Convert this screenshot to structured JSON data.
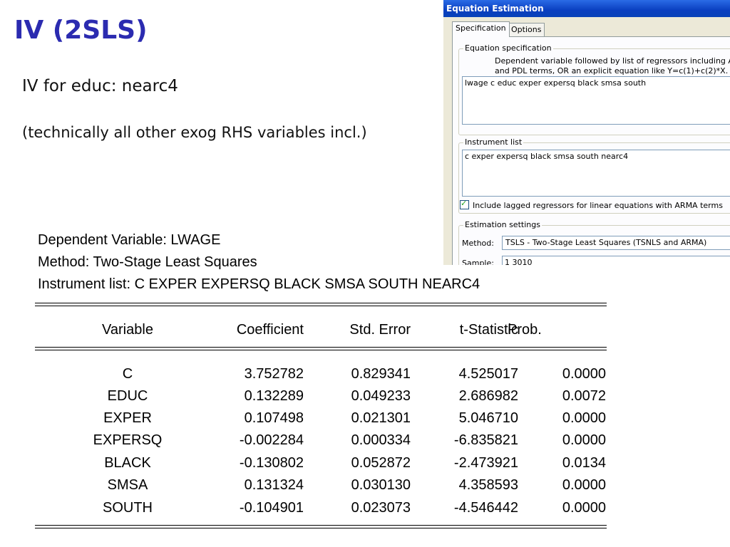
{
  "slide": {
    "title": "IV (2SLS)",
    "line1": "IV for educ: nearc4",
    "line2": "(technically all other exog RHS variables incl.)"
  },
  "output": {
    "dependent": "Dependent Variable: LWAGE",
    "method": "Method: Two-Stage Least Squares",
    "instruments": "Instrument list: C EXPER EXPERSQ BLACK SMSA SOUTH NEARC4",
    "headers": [
      "Variable",
      "Coefficient",
      "Std. Error",
      "t-Statistic",
      "Prob."
    ],
    "rows": [
      {
        "variable": "C",
        "coef": "3.752782",
        "se": "0.829341",
        "t": "4.525017",
        "p": "0.0000"
      },
      {
        "variable": "EDUC",
        "coef": "0.132289",
        "se": "0.049233",
        "t": "2.686982",
        "p": "0.0072"
      },
      {
        "variable": "EXPER",
        "coef": "0.107498",
        "se": "0.021301",
        "t": "5.046710",
        "p": "0.0000"
      },
      {
        "variable": "EXPERSQ",
        "coef": "-0.002284",
        "se": "0.000334",
        "t": "-6.835821",
        "p": "0.0000"
      },
      {
        "variable": "BLACK",
        "coef": "-0.130802",
        "se": "0.052872",
        "t": "-2.473921",
        "p": "0.0134"
      },
      {
        "variable": "SMSA",
        "coef": "0.131324",
        "se": "0.030130",
        "t": "4.358593",
        "p": "0.0000"
      },
      {
        "variable": "SOUTH",
        "coef": "-0.104901",
        "se": "0.023073",
        "t": "-4.546442",
        "p": "0.0000"
      }
    ]
  },
  "dialog": {
    "title": "Equation Estimation",
    "tabs": [
      "Specification",
      "Options"
    ],
    "eq_group_label": "Equation specification",
    "eq_hint_1": "Dependent variable followed by list of regressors including ARMA",
    "eq_hint_2": "and PDL terms, OR an explicit equation like Y=c(1)+c(2)*X.",
    "equation": "lwage c educ exper expersq black smsa south",
    "instr_group_label": "Instrument list",
    "instruments": "c exper expersq black smsa south nearc4",
    "checkbox_label": "Include lagged regressors for linear equations with ARMA terms",
    "checkbox_checked": true,
    "est_group_label": "Estimation settings",
    "method_label": "Method:",
    "method_value": "TSLS  -  Two-Stage Least Squares (TSNLS and ARMA)",
    "sample_label": "Sample:",
    "sample_value": "1 3010"
  },
  "colors": {
    "title": "#2b2bb0",
    "dialog_bg": "#ece9d8",
    "titlebar": "#0a3fc0"
  }
}
